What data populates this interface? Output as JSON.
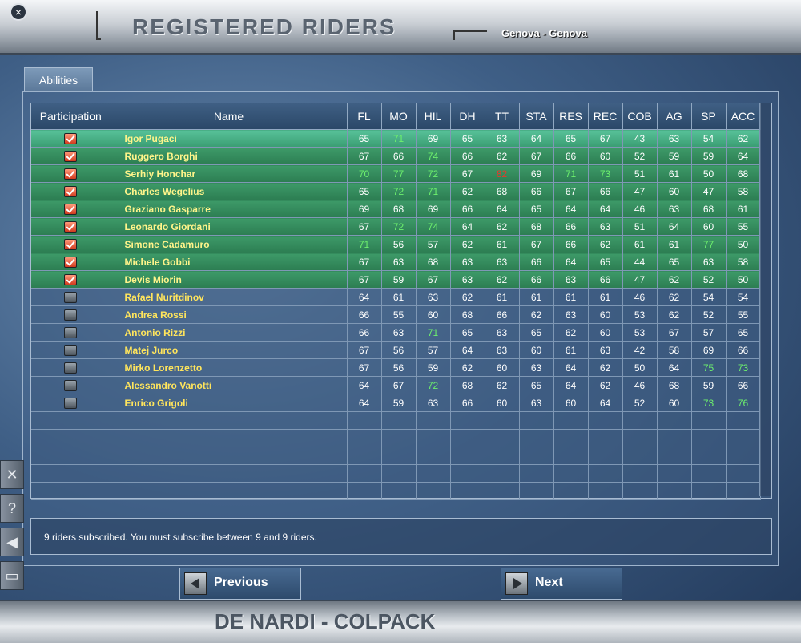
{
  "header": {
    "title": "REGISTERED RIDERS",
    "race": "Genova - Genova",
    "close_glyph": "×"
  },
  "tab": {
    "label": "Abilities"
  },
  "table": {
    "columns": [
      "Participation",
      "Name",
      "FL",
      "MO",
      "HIL",
      "DH",
      "TT",
      "STA",
      "RES",
      "REC",
      "COB",
      "AG",
      "SP",
      "ACC"
    ],
    "rows": [
      {
        "checked": true,
        "name": "Igor Pugaci",
        "stats": [
          65,
          71,
          69,
          65,
          63,
          64,
          65,
          67,
          43,
          63,
          54,
          62
        ],
        "hl": [
          "",
          "pos",
          "",
          "",
          "",
          "",
          "",
          "",
          "",
          "",
          "",
          ""
        ]
      },
      {
        "checked": true,
        "name": "Ruggero Borghi",
        "stats": [
          67,
          66,
          74,
          66,
          62,
          67,
          66,
          60,
          52,
          59,
          59,
          64
        ],
        "hl": [
          "",
          "",
          "pos",
          "",
          "",
          "",
          "",
          "",
          "",
          "",
          "",
          ""
        ]
      },
      {
        "checked": true,
        "name": "Serhiy Honchar",
        "stats": [
          70,
          77,
          72,
          67,
          82,
          69,
          71,
          73,
          51,
          61,
          50,
          68
        ],
        "hl": [
          "pos",
          "pos",
          "pos",
          "",
          "neg",
          "",
          "pos",
          "pos",
          "",
          "",
          "",
          ""
        ]
      },
      {
        "checked": true,
        "name": "Charles Wegelius",
        "stats": [
          65,
          72,
          71,
          62,
          68,
          66,
          67,
          66,
          47,
          60,
          47,
          58
        ],
        "hl": [
          "",
          "pos",
          "pos",
          "",
          "",
          "",
          "",
          "",
          "",
          "",
          "",
          ""
        ]
      },
      {
        "checked": true,
        "name": "Graziano Gasparre",
        "stats": [
          69,
          68,
          69,
          66,
          64,
          65,
          64,
          64,
          46,
          63,
          68,
          61
        ],
        "hl": [
          "",
          "",
          "",
          "",
          "",
          "",
          "",
          "",
          "",
          "",
          "",
          ""
        ]
      },
      {
        "checked": true,
        "name": "Leonardo Giordani",
        "stats": [
          67,
          72,
          74,
          64,
          62,
          68,
          66,
          63,
          51,
          64,
          60,
          55
        ],
        "hl": [
          "",
          "pos",
          "pos",
          "",
          "",
          "",
          "",
          "",
          "",
          "",
          "",
          ""
        ]
      },
      {
        "checked": true,
        "name": "Simone Cadamuro",
        "stats": [
          71,
          56,
          57,
          62,
          61,
          67,
          66,
          62,
          61,
          61,
          77,
          50
        ],
        "hl": [
          "pos",
          "",
          "",
          "",
          "",
          "",
          "",
          "",
          "",
          "",
          "pos",
          ""
        ]
      },
      {
        "checked": true,
        "name": "Michele Gobbi",
        "stats": [
          67,
          63,
          68,
          63,
          63,
          66,
          64,
          65,
          44,
          65,
          63,
          58
        ],
        "hl": [
          "",
          "",
          "",
          "",
          "",
          "",
          "",
          "",
          "",
          "",
          "",
          ""
        ]
      },
      {
        "checked": true,
        "name": "Devis Miorin",
        "stats": [
          67,
          59,
          67,
          63,
          62,
          66,
          63,
          66,
          47,
          62,
          52,
          50
        ],
        "hl": [
          "",
          "",
          "",
          "",
          "",
          "",
          "",
          "",
          "",
          "",
          "",
          ""
        ]
      },
      {
        "checked": false,
        "name": "Rafael Nuritdinov",
        "stats": [
          64,
          61,
          63,
          62,
          61,
          61,
          61,
          61,
          46,
          62,
          54,
          54
        ],
        "hl": [
          "",
          "",
          "",
          "",
          "",
          "",
          "",
          "",
          "",
          "",
          "",
          ""
        ]
      },
      {
        "checked": false,
        "name": "Andrea Rossi",
        "stats": [
          66,
          55,
          60,
          68,
          66,
          62,
          63,
          60,
          53,
          62,
          52,
          55
        ],
        "hl": [
          "",
          "",
          "",
          "",
          "",
          "",
          "",
          "",
          "",
          "",
          "",
          ""
        ]
      },
      {
        "checked": false,
        "name": "Antonio Rizzi",
        "stats": [
          66,
          63,
          71,
          65,
          63,
          65,
          62,
          60,
          53,
          67,
          57,
          65
        ],
        "hl": [
          "",
          "",
          "pos",
          "",
          "",
          "",
          "",
          "",
          "",
          "",
          "",
          ""
        ]
      },
      {
        "checked": false,
        "name": "Matej Jurco",
        "stats": [
          67,
          56,
          57,
          64,
          63,
          60,
          61,
          63,
          42,
          58,
          69,
          66
        ],
        "hl": [
          "",
          "",
          "",
          "",
          "",
          "",
          "",
          "",
          "",
          "",
          "",
          ""
        ]
      },
      {
        "checked": false,
        "name": "Mirko Lorenzetto",
        "stats": [
          67,
          56,
          59,
          62,
          60,
          63,
          64,
          62,
          50,
          64,
          75,
          73
        ],
        "hl": [
          "",
          "",
          "",
          "",
          "",
          "",
          "",
          "",
          "",
          "",
          "pos",
          "pos"
        ]
      },
      {
        "checked": false,
        "name": "Alessandro Vanotti",
        "stats": [
          64,
          67,
          72,
          68,
          62,
          65,
          64,
          62,
          46,
          68,
          59,
          66
        ],
        "hl": [
          "",
          "",
          "pos",
          "",
          "",
          "",
          "",
          "",
          "",
          "",
          "",
          ""
        ]
      },
      {
        "checked": false,
        "name": "Enrico Grigoli",
        "stats": [
          64,
          59,
          63,
          66,
          60,
          63,
          60,
          64,
          52,
          60,
          73,
          76
        ],
        "hl": [
          "",
          "",
          "",
          "",
          "",
          "",
          "",
          "",
          "",
          "",
          "pos",
          "pos"
        ]
      }
    ],
    "empty_rows": 5
  },
  "status": {
    "message": "9 riders subscribed. You must subscribe between 9 and  9 riders."
  },
  "nav": {
    "previous": "Previous",
    "next": "Next"
  },
  "footer": {
    "team": "DE NARDI - COLPACK"
  },
  "side_tools": [
    {
      "icon": "tools-icon",
      "glyph": "✕"
    },
    {
      "icon": "help-icon",
      "glyph": "?"
    },
    {
      "icon": "sound-icon",
      "glyph": "◀"
    },
    {
      "icon": "chat-icon",
      "glyph": "▭"
    }
  ],
  "colors": {
    "positive": "#6df06d",
    "negative": "#e8382a",
    "name": "#ffe55c"
  }
}
